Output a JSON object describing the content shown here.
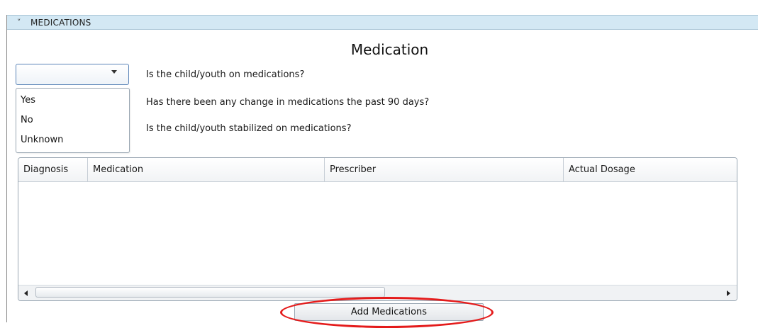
{
  "section": {
    "title": "MEDICATIONS",
    "heading": "Medication"
  },
  "combo": {
    "selected": "",
    "options": [
      "Yes",
      "No",
      "Unknown"
    ]
  },
  "questions": [
    "Is the child/youth on medications?",
    "Has there been any change in medications the past 90 days?",
    "Is the child/youth stabilized on medications?"
  ],
  "grid": {
    "columns": [
      "Diagnosis",
      "Medication",
      "Prescriber",
      "Actual Dosage"
    ],
    "rows": []
  },
  "buttons": {
    "add_medications": "Add Medications"
  },
  "colors": {
    "header_bar": "#d3e8f4",
    "annotation_ellipse": "#e41b1b"
  },
  "icons": {
    "collapse": "chevron-down-icon",
    "combo_arrow": "caret-down-icon",
    "scroll_left": "arrow-left-icon",
    "scroll_right": "arrow-right-icon"
  }
}
